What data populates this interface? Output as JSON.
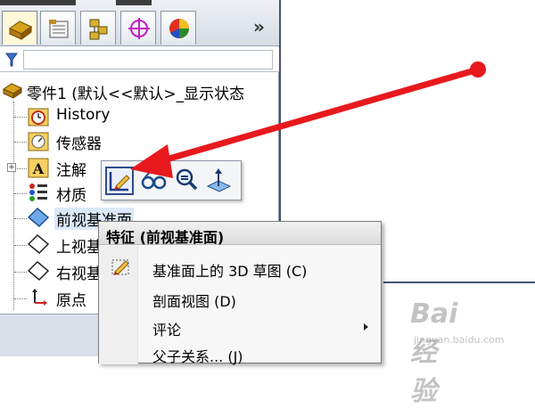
{
  "toolbar": {
    "tabs": [
      {
        "icon": "feature-manager-icon"
      },
      {
        "icon": "property-manager-icon"
      },
      {
        "icon": "configuration-manager-icon"
      },
      {
        "icon": "dimxpert-icon"
      },
      {
        "icon": "display-manager-icon"
      }
    ],
    "more_label": "»"
  },
  "filter": {
    "icon": "filter-icon",
    "value": ""
  },
  "tree": {
    "root": "零件1 (默认<<默认>_显示状态",
    "items": [
      {
        "label": "History",
        "icon": "history-icon"
      },
      {
        "label": "传感器",
        "icon": "sensor-icon"
      },
      {
        "label": "注解",
        "icon": "annotation-icon"
      },
      {
        "label": "材质",
        "icon": "material-icon"
      },
      {
        "label": "前视基准面",
        "icon": "plane-icon"
      },
      {
        "label": "上视基",
        "icon": "plane-icon"
      },
      {
        "label": "右视基",
        "icon": "plane-icon"
      },
      {
        "label": "原点",
        "icon": "origin-icon"
      }
    ]
  },
  "context_toolbar": {
    "buttons": [
      "sketch-icon",
      "appearance-icon",
      "zoom-to-selection-icon",
      "normal-to-icon"
    ]
  },
  "context_menu": {
    "title": "特征 (前视基准面)",
    "items": [
      {
        "label": "基准面上的 3D 草图 (C)",
        "icon": "3d-sketch-icon"
      },
      {
        "label": "剖面视图 (D)",
        "icon": ""
      },
      {
        "label": "评论",
        "icon": "",
        "submenu": true
      },
      {
        "label": "父子关系... (J)",
        "icon": ""
      }
    ]
  },
  "watermark": {
    "main": "Bai 经验",
    "sub": "jingyan.baidu.com"
  },
  "colors": {
    "annotation_arrow": "#e8191d",
    "selection": "#dbe9fb",
    "toolbar_active_border": "#2b4c8c"
  }
}
